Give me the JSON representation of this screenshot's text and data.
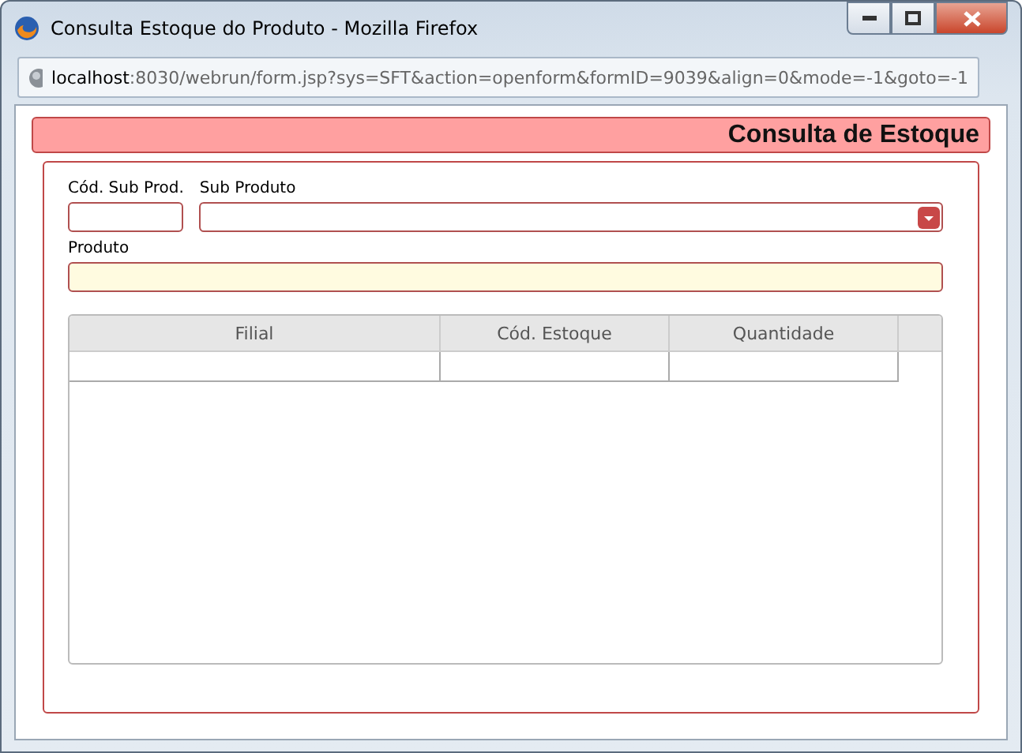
{
  "window": {
    "title": "Consulta Estoque do Produto - Mozilla Firefox"
  },
  "address_bar": {
    "host": "localhost",
    "path": ":8030/webrun/form.jsp?sys=SFT&action=openform&formID=9039&align=0&mode=-1&goto=-1"
  },
  "header": {
    "title": "Consulta de Estoque"
  },
  "fields": [
    {
      "label": "Cód. Sub Prod.",
      "kind": "text"
    },
    {
      "label": "Sub Produto",
      "kind": "select"
    },
    {
      "label": "Produto",
      "kind": "readonly"
    }
  ],
  "table": {
    "columns": [
      "Filial",
      "Cód. Estoque",
      "Quantidade"
    ]
  }
}
